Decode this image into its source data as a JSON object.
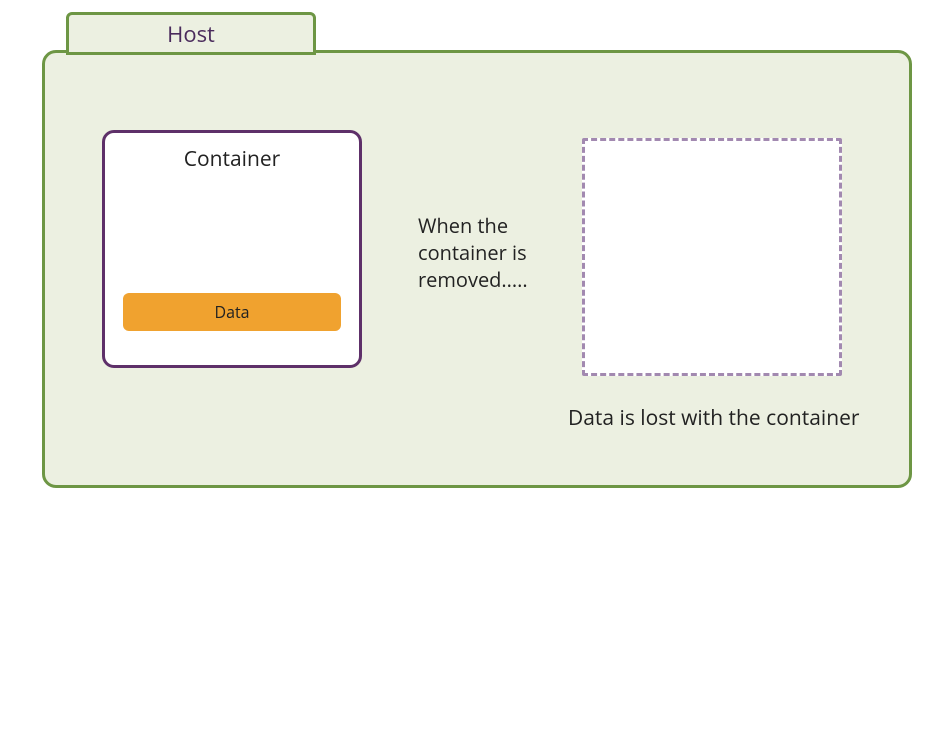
{
  "host": {
    "tab_label": "Host"
  },
  "container": {
    "title": "Container",
    "data_label": "Data"
  },
  "messages": {
    "removal": "When the container is removed.....",
    "lost": "Data is lost with the container"
  }
}
